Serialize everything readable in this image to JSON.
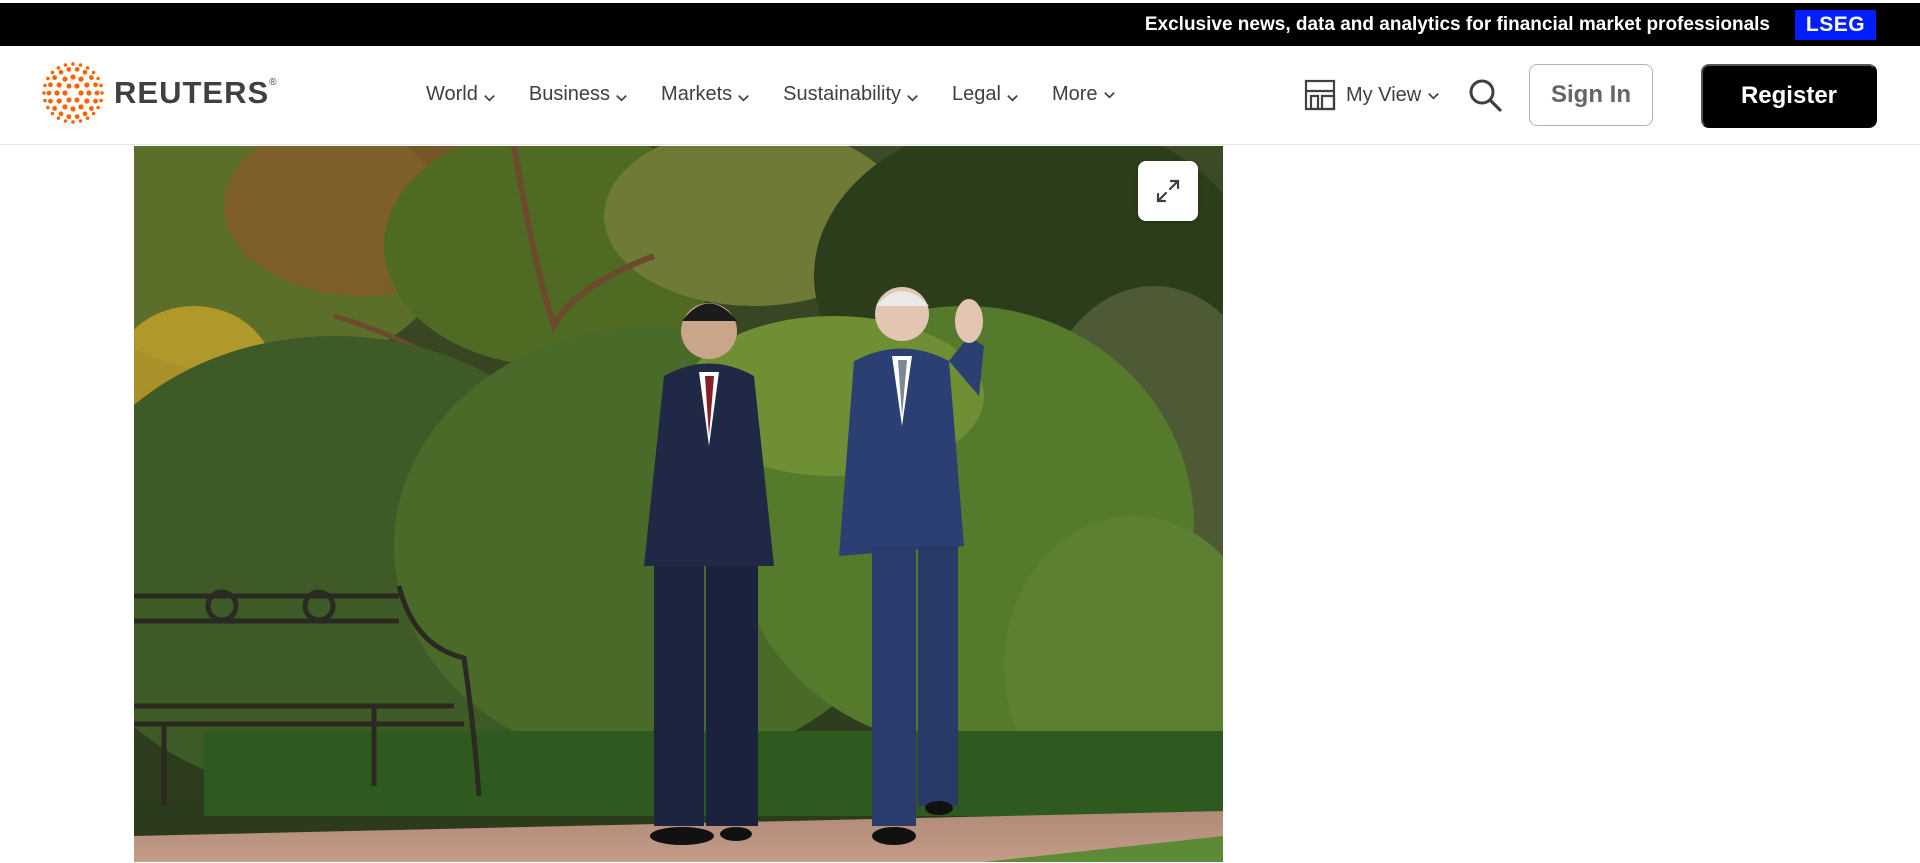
{
  "topbar": {
    "text": "Exclusive news, data and analytics for financial market professionals",
    "badge": "LSEG",
    "badge_color": "#001eff"
  },
  "header": {
    "logo_text": "REUTERS",
    "logo_mark": "®",
    "logo_color": "#fa6400",
    "nav": [
      {
        "label": "World",
        "icon": "chevron-down-icon"
      },
      {
        "label": "Business",
        "icon": "chevron-down-icon"
      },
      {
        "label": "Markets",
        "icon": "chevron-down-icon"
      },
      {
        "label": "Sustainability",
        "icon": "chevron-down-icon"
      },
      {
        "label": "Legal",
        "icon": "chevron-down-icon"
      },
      {
        "label": "More",
        "icon": "chevron-down-icon"
      }
    ],
    "my_view": {
      "label": "My View",
      "icon": "layout-icon"
    },
    "search_icon": "search-icon",
    "sign_in": "Sign In",
    "register": "Register"
  },
  "article": {
    "photo": {
      "description_icon": "photo",
      "expand_icon": "expand-icon"
    }
  }
}
